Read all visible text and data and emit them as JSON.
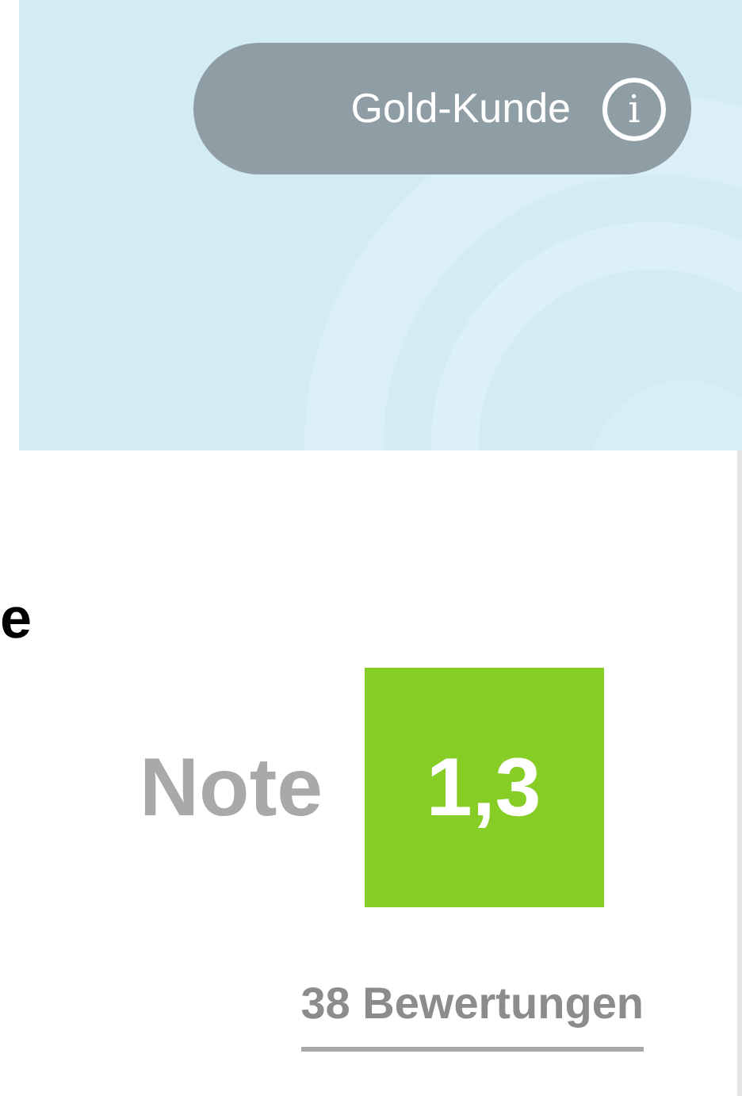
{
  "banner": {
    "kind": "picture",
    "badge": {
      "label": "Gold-Kunde",
      "icon": "i"
    }
  },
  "title_fragment": "e",
  "rating": {
    "label": "Note",
    "grade": "1,3",
    "reviews_link": "38 Bewertungen"
  }
}
